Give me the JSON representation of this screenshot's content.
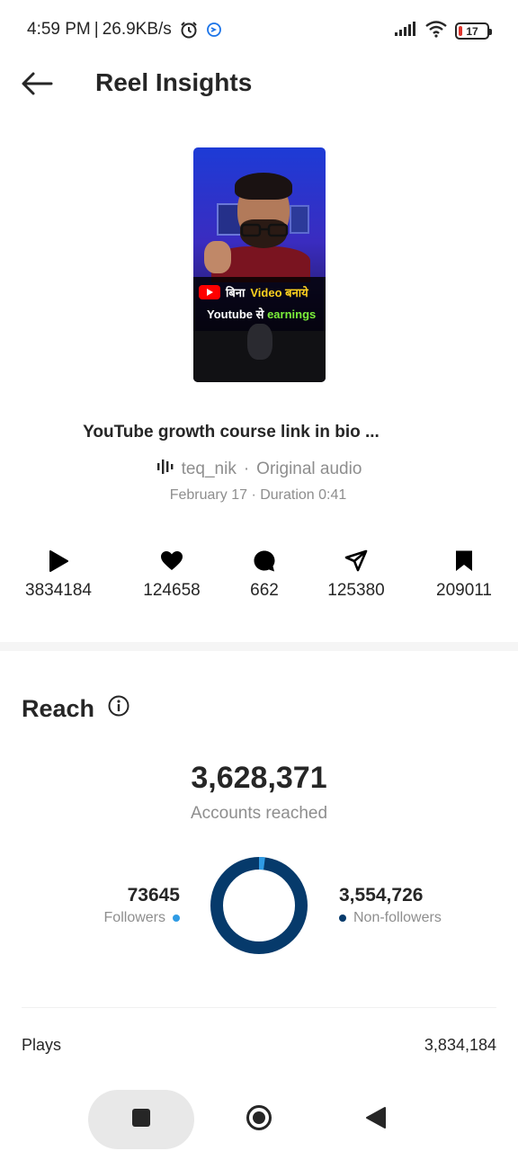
{
  "status_bar": {
    "time": "4:59 PM",
    "separator": "|",
    "speed": "26.9KB/s",
    "battery": "17",
    "battery_color": "#e0342c"
  },
  "header": {
    "title": "Reel Insights"
  },
  "reel": {
    "thumb_line1_a": "बिना",
    "thumb_line1_b": "Video बनाये",
    "thumb_line2_a": "Youtube से",
    "thumb_line2_b": "earnings",
    "caption": "YouTube growth course link in bio ...",
    "audio_user": "teq_nik",
    "audio_sep": "·",
    "audio_label": "Original audio",
    "date": "February 17",
    "meta_sep": "·",
    "duration": "Duration 0:41"
  },
  "stats": {
    "plays": "3834184",
    "likes": "124658",
    "comments": "662",
    "shares": "125380",
    "saves": "209011"
  },
  "reach": {
    "title": "Reach",
    "total": "3,628,371",
    "subtitle": "Accounts reached",
    "followers_value": "73645",
    "followers_label": "Followers",
    "followers_color": "#2f9be4",
    "nonfollowers_value": "3,554,726",
    "nonfollowers_label": "Non-followers",
    "nonfollowers_color": "#063a6b",
    "followers_fraction": 0.0203
  },
  "plays_row": {
    "label": "Plays",
    "value": "3,834,184"
  },
  "icons": {
    "back": "arrow-left-icon",
    "play": "play-icon",
    "like": "heart-icon",
    "comment": "comment-icon",
    "share": "send-icon",
    "save": "bookmark-icon",
    "info": "info-icon",
    "audio": "waveform-icon"
  }
}
